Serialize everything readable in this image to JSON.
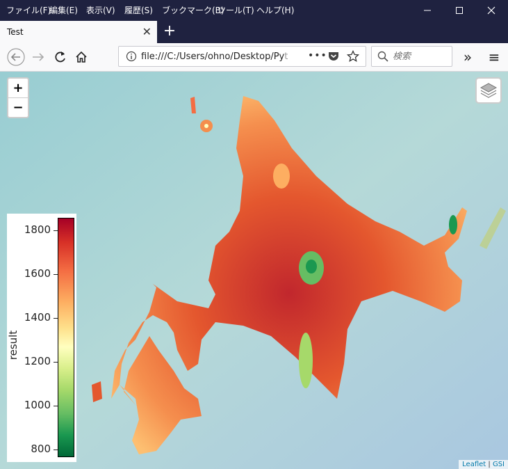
{
  "menu": [
    "ファイル(F)",
    "編集(E)",
    "表示(V)",
    "履歴(S)",
    "ブックマーク(B)",
    "ツール(T)",
    "ヘルプ(H)"
  ],
  "window_controls": {
    "minimize": "—",
    "maximize": "☐",
    "close": "✕"
  },
  "tab": {
    "title": "Test",
    "close": "✕",
    "new_tab": "+"
  },
  "nav": {
    "url": "file:///C:/Users/ohno/Desktop/Py",
    "url_faded": "t",
    "page_actions": "•••",
    "search_placeholder": "検索",
    "overflow": "»",
    "menu": "≡"
  },
  "map": {
    "zoom_in": "+",
    "zoom_out": "−",
    "attribution_leaflet": "Leaflet",
    "attribution_sep": " | ",
    "attribution_gsi": "GSI"
  },
  "legend": {
    "label": "result",
    "ticks": [
      "1800",
      "1600",
      "1400",
      "1200",
      "1000",
      "800"
    ],
    "colors": [
      "#a50026",
      "#d73027",
      "#f46d43",
      "#fdae61",
      "#fee08b",
      "#ffffbf",
      "#d9ef8b",
      "#a6d96a",
      "#66bd63",
      "#1a9850",
      "#006837"
    ]
  },
  "theme": {
    "titlebar": "#1f2240",
    "sea": "#a9d3d6",
    "land_high": "#d73027",
    "land_low": "#fdae61"
  }
}
